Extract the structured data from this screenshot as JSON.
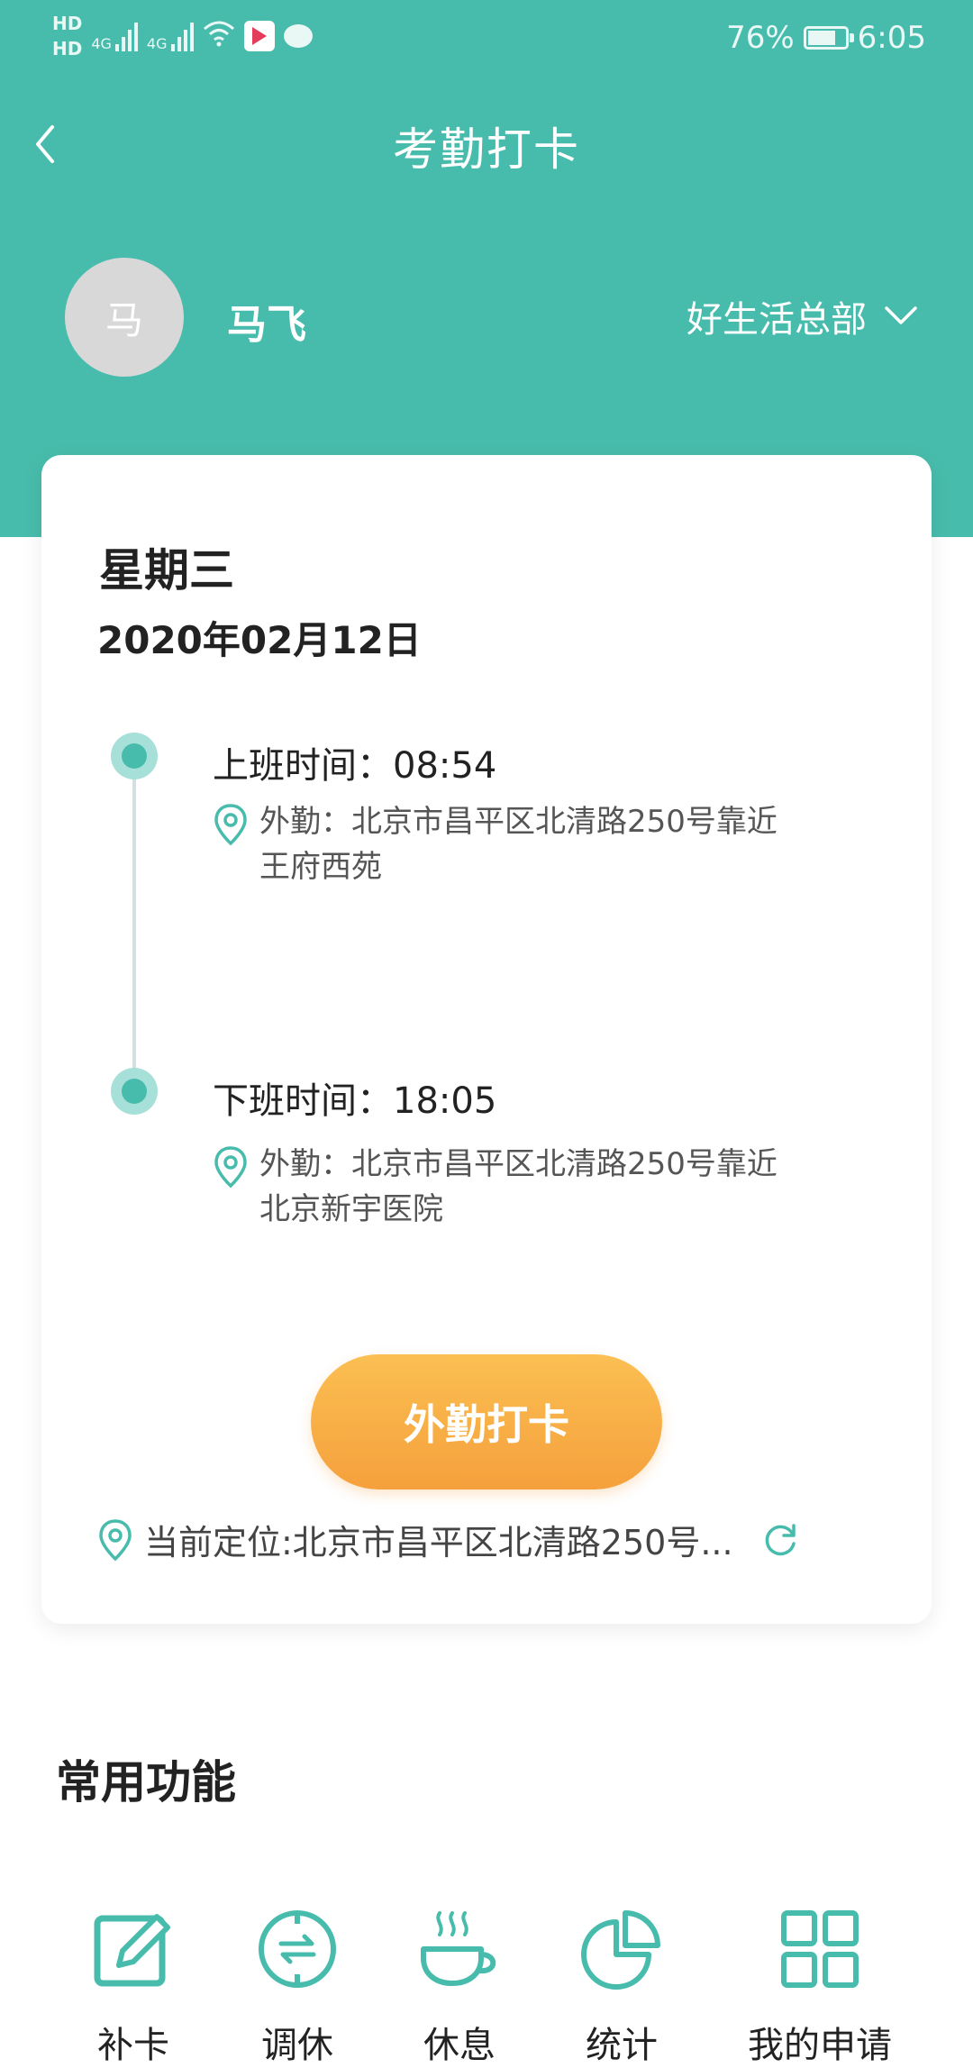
{
  "status_bar": {
    "hd1": "HD",
    "hd2": "HD",
    "signal1": "4G",
    "signal2": "4G",
    "battery_percent": "76%",
    "battery_level": 0.76,
    "time": "6:05"
  },
  "header": {
    "title": "考勤打卡"
  },
  "user": {
    "avatar_text": "马",
    "name": "马飞",
    "department": "好生活总部"
  },
  "card": {
    "weekday": "星期三",
    "date": "2020年02月12日",
    "records": [
      {
        "label": "上班时间：08:54",
        "address": "外勤：北京市昌平区北清路250号靠近王府西苑"
      },
      {
        "label": "下班时间：18:05",
        "address": "外勤：北京市昌平区北清路250号靠近北京新宇医院"
      }
    ],
    "checkin_button": "外勤打卡",
    "current_location": "当前定位:北京市昌平区北清路250号..."
  },
  "functions": {
    "title": "常用功能",
    "items": [
      {
        "label": "补卡",
        "icon": "edit-icon"
      },
      {
        "label": "调休",
        "icon": "exchange-icon"
      },
      {
        "label": "休息",
        "icon": "coffee-icon"
      },
      {
        "label": "统计",
        "icon": "pie-chart-icon"
      },
      {
        "label": "我的申请",
        "icon": "grid-icon"
      }
    ]
  },
  "colors": {
    "accent": "#48bcac",
    "button": "#f8ad45"
  }
}
